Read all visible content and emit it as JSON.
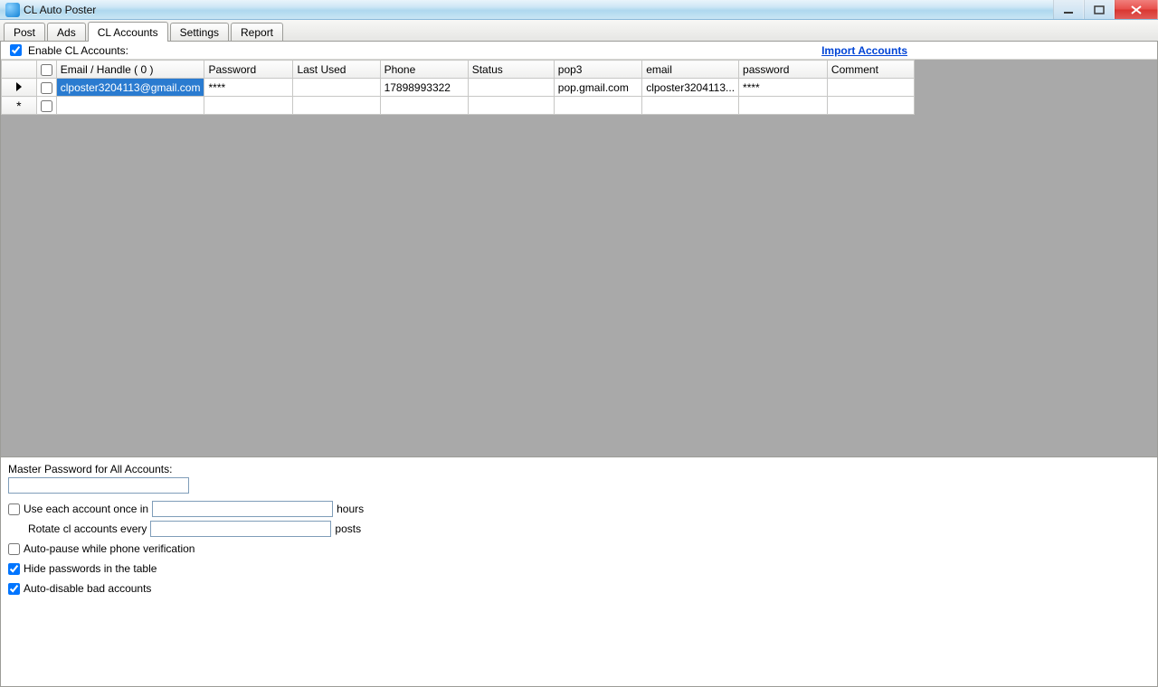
{
  "window": {
    "title": "CL Auto Poster"
  },
  "tabs": {
    "post": "Post",
    "ads": "Ads",
    "accounts": "CL Accounts",
    "settings": "Settings",
    "report": "Report"
  },
  "top": {
    "enable_label": "Enable CL Accounts:",
    "import_link": "Import Accounts"
  },
  "grid": {
    "head": {
      "email": "Email / Handle ( 0 )",
      "password": "Password",
      "last": "Last Used",
      "phone": "Phone",
      "status": "Status",
      "pop3": "pop3",
      "email2": "email",
      "pass2": "password",
      "comment": "Comment"
    },
    "row0": {
      "email": "clposter3204113@gmail.com",
      "password": "****",
      "last": "",
      "phone": "17898993322",
      "status": "",
      "pop3": "pop.gmail.com",
      "email2": "clposter3204113...",
      "pass2": "****",
      "comment": ""
    }
  },
  "options": {
    "master_label": "Master Password for All Accounts:",
    "use_each_pre": "Use each account once in",
    "use_each_post": "hours",
    "rotate_pre": "Rotate cl accounts  every",
    "rotate_post": "posts",
    "autopause": "Auto-pause while phone verification",
    "hidepw": "Hide passwords in the table",
    "autodisable": "Auto-disable bad accounts"
  },
  "state": {
    "enable_checked": true,
    "hidepw_checked": true,
    "autodisable_checked": true,
    "autopause_checked": false,
    "useeach_checked": false
  }
}
